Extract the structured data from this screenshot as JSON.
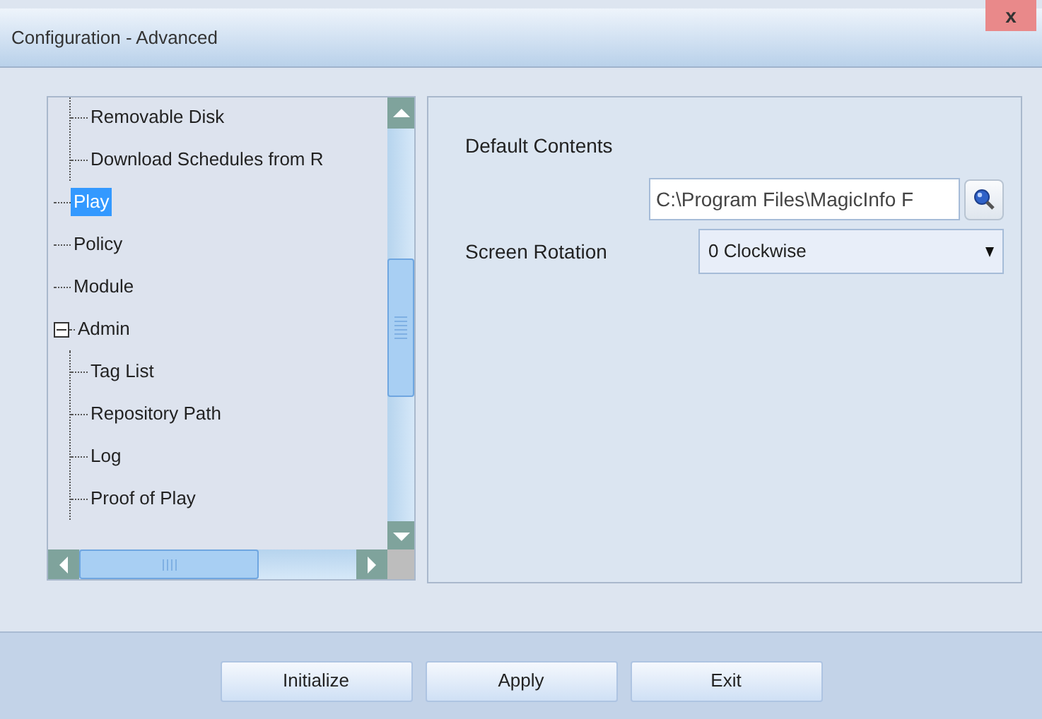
{
  "window": {
    "title": "Configuration - Advanced",
    "close": "x"
  },
  "tree": {
    "items": [
      {
        "children": [
          {
            "label": "Removable Disk",
            "selected": false
          },
          {
            "label": "Download Schedules from R",
            "selected": false
          }
        ]
      },
      {
        "label": "Play",
        "selected": true
      },
      {
        "label": "Policy",
        "selected": false
      },
      {
        "label": "Module",
        "selected": false
      },
      {
        "label": "Admin",
        "selected": false,
        "expanded": true,
        "children": [
          {
            "label": "Tag List",
            "selected": false
          },
          {
            "label": "Repository Path",
            "selected": false
          },
          {
            "label": "Log",
            "selected": false
          },
          {
            "label": "Proof of Play",
            "selected": false
          }
        ]
      }
    ]
  },
  "settings": {
    "default_contents": {
      "label": "Default Contents",
      "value": "C:\\Program Files\\MagicInfo F"
    },
    "screen_rotation": {
      "label": "Screen Rotation",
      "value": "0 Clockwise"
    }
  },
  "buttons": [
    "Initialize",
    "Apply",
    "Exit"
  ]
}
